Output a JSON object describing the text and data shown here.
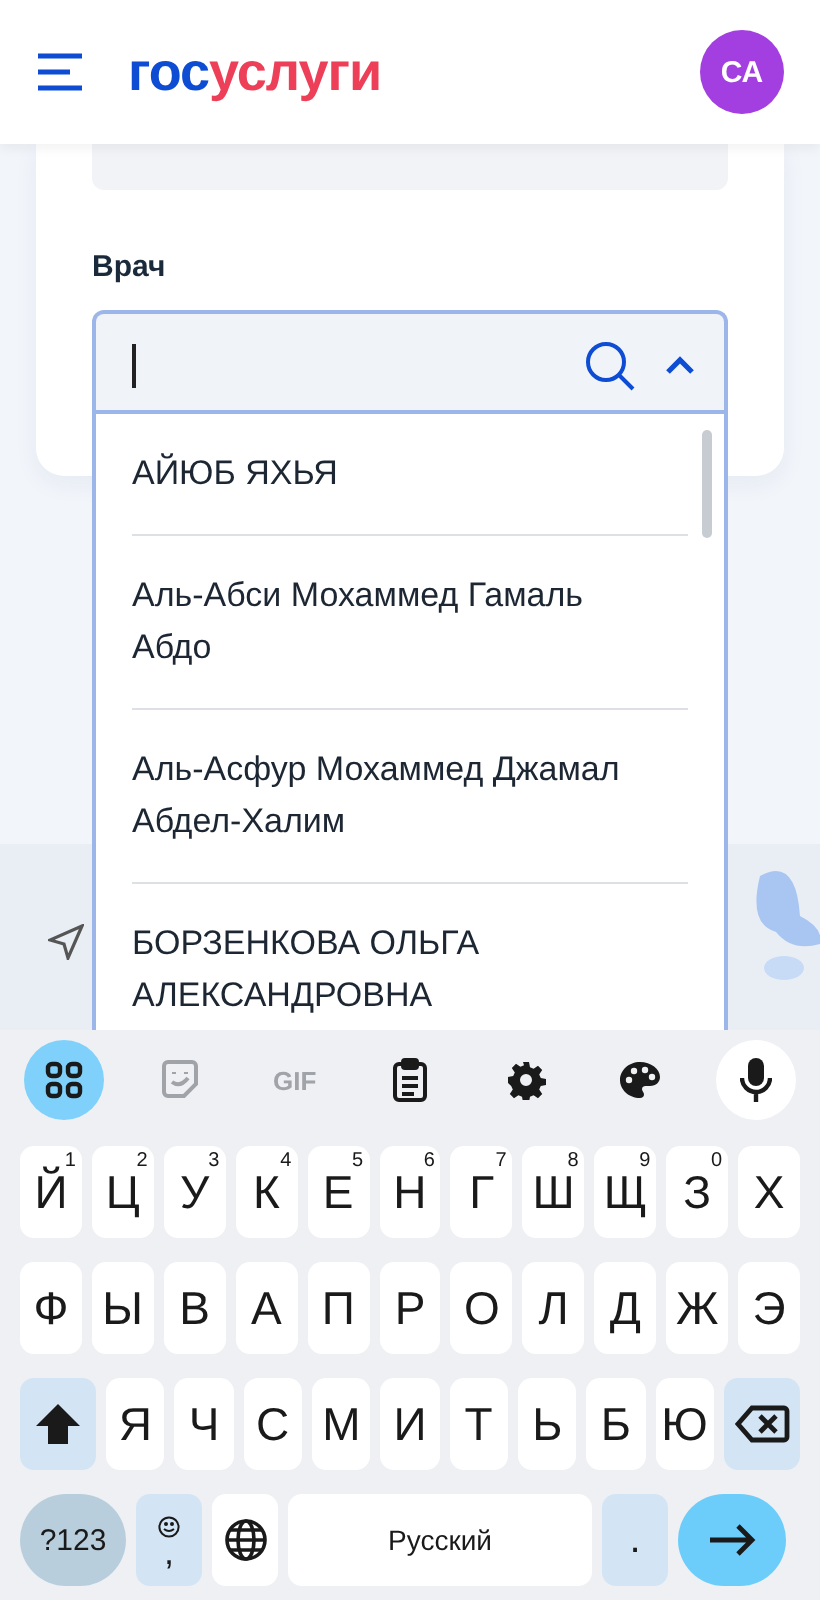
{
  "header": {
    "logo": [
      {
        "text": "гос",
        "color": "#0d4cd3"
      },
      {
        "text": "услуги",
        "color": "#ee3f58"
      }
    ],
    "avatar": "СА"
  },
  "form": {
    "label": "Врач",
    "options": [
      {
        "text": "АЙЮБ ЯХЬЯ"
      },
      {
        "text": "Аль-Абси Мохаммед Гамаль Абдо"
      },
      {
        "text": "Аль-Асфур Мохаммед Джамал Абдел-Халим"
      },
      {
        "text": "БОРЗЕНКОВА ОЛЬГА АЛЕКСАНДРОВНА"
      }
    ]
  },
  "keyboard": {
    "toolbar": [
      {
        "kind": "apps"
      },
      {
        "kind": "sticker"
      },
      {
        "kind": "gif",
        "label": "GIF"
      },
      {
        "kind": "clipboard"
      },
      {
        "kind": "settings"
      },
      {
        "kind": "palette"
      },
      {
        "kind": "mic"
      }
    ],
    "rows": [
      {
        "keys": [
          {
            "label": "Й",
            "hint": "1"
          },
          {
            "label": "Ц",
            "hint": "2"
          },
          {
            "label": "У",
            "hint": "3"
          },
          {
            "label": "К",
            "hint": "4"
          },
          {
            "label": "Е",
            "hint": "5"
          },
          {
            "label": "Н",
            "hint": "6"
          },
          {
            "label": "Г",
            "hint": "7"
          },
          {
            "label": "Ш",
            "hint": "8"
          },
          {
            "label": "Щ",
            "hint": "9"
          },
          {
            "label": "З",
            "hint": "0"
          },
          {
            "label": "Х"
          }
        ]
      },
      {
        "keys": [
          {
            "label": "Ф"
          },
          {
            "label": "Ы"
          },
          {
            "label": "В"
          },
          {
            "label": "А"
          },
          {
            "label": "П"
          },
          {
            "label": "Р"
          },
          {
            "label": "О"
          },
          {
            "label": "Л"
          },
          {
            "label": "Д"
          },
          {
            "label": "Ж"
          },
          {
            "label": "Э"
          }
        ]
      },
      {
        "keys": [
          {
            "kind": "shift"
          },
          {
            "label": "Я"
          },
          {
            "label": "Ч"
          },
          {
            "label": "С"
          },
          {
            "label": "М"
          },
          {
            "label": "И"
          },
          {
            "label": "Т"
          },
          {
            "label": "Ь"
          },
          {
            "label": "Б"
          },
          {
            "label": "Ю"
          },
          {
            "kind": "backspace"
          }
        ]
      },
      {
        "keys": [
          {
            "kind": "symbols",
            "label": "?123"
          },
          {
            "kind": "emoji-comma",
            "label": ","
          },
          {
            "kind": "globe"
          },
          {
            "kind": "space",
            "label": "Русский"
          },
          {
            "kind": "period",
            "label": "."
          },
          {
            "kind": "enter"
          }
        ]
      }
    ]
  }
}
